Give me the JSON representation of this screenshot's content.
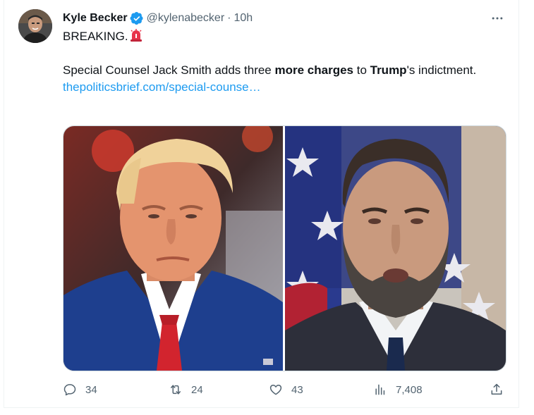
{
  "tweet": {
    "author_name": "Kyle Becker",
    "handle": "@kylenabecker",
    "separator": "·",
    "time": "10h",
    "line1": "BREAKING.",
    "line2_a": "Special Counsel Jack Smith adds three ",
    "line2_b": "more charges",
    "line2_c": " to ",
    "line2_d": "Trump",
    "line2_e": "'s indictment.",
    "link": "thepoliticsbrief.com/special-counse…"
  },
  "actions": {
    "replies": "34",
    "reposts": "24",
    "likes": "43",
    "views": "7,408"
  },
  "colors": {
    "accent": "#1d9bf0",
    "muted": "#536471",
    "text": "#0f1419"
  },
  "icons": [
    "verified-badge-icon",
    "siren-emoji-icon",
    "more-icon",
    "reply-icon",
    "repost-icon",
    "like-icon",
    "views-icon",
    "share-icon"
  ]
}
